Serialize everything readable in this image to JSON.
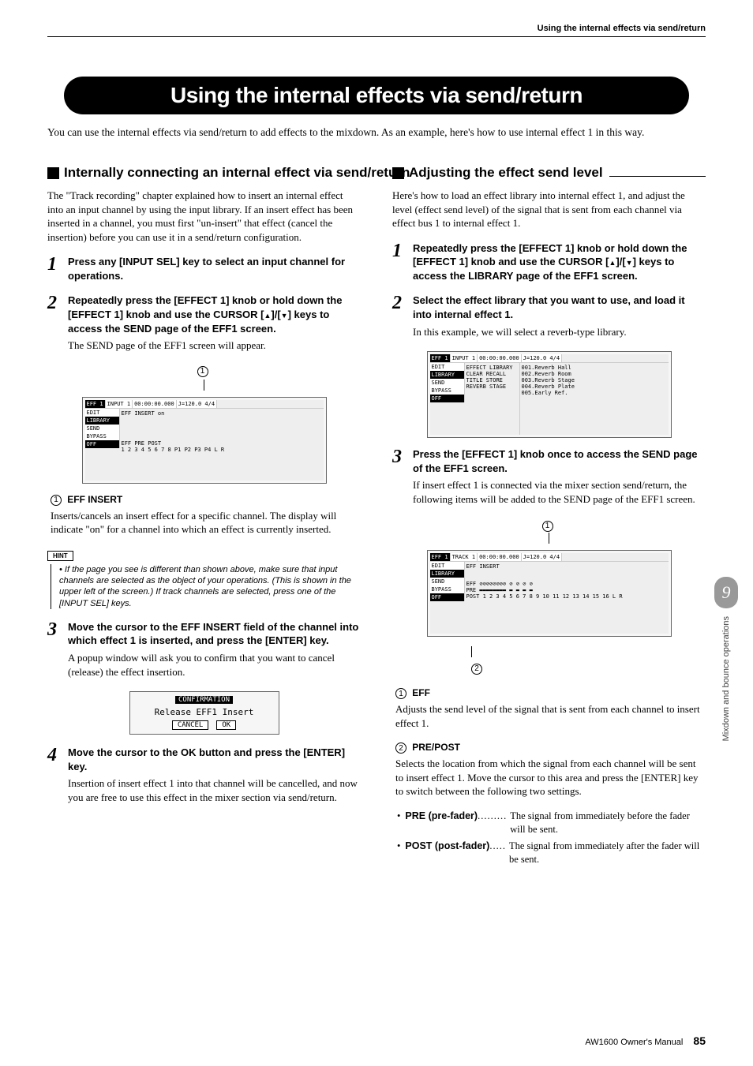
{
  "header": {
    "section": "Using the internal effects via send/return"
  },
  "title": "Using the internal effects via send/return",
  "intro": "You can use the internal effects via send/return to add effects to the mixdown. As an example, here's how to use internal effect 1 in this way.",
  "left": {
    "heading": "Internally connecting an internal effect via send/return",
    "para1": "The \"Track recording\" chapter explained how to insert an internal effect into an input channel by using the input library. If an insert effect has been inserted in a channel, you must first \"un-insert\" that effect (cancel the insertion) before you can use it in a send/return configuration.",
    "step1": {
      "num": "1",
      "title": "Press any [INPUT SEL] key to select an input channel for operations."
    },
    "step2": {
      "num": "2",
      "title_a": "Repeatedly press the [EFFECT 1] knob or hold down the [EFFECT 1] knob and use the CURSOR [",
      "title_b": "]/[",
      "title_c": "] keys to access the SEND page of the EFF1 screen.",
      "desc": "The SEND page of the EFF1 screen will appear."
    },
    "callout1": {
      "num": "1",
      "label": "EFF INSERT",
      "desc": "Inserts/cancels an insert effect for a specific channel. The display will indicate \"on\" for a channel into which an effect is currently inserted."
    },
    "hint": {
      "label": "HINT",
      "text": "• If the page you see is different than shown above, make sure that input channels are selected as the object of your operations. (This is shown in the upper left of the screen.) If track channels are selected, press one of the [INPUT SEL] keys."
    },
    "step3": {
      "num": "3",
      "title": "Move the cursor to the EFF INSERT field of the channel into which effect 1 is inserted, and press the [ENTER] key.",
      "desc": "A popup window will ask you to confirm that you want to cancel (release) the effect insertion."
    },
    "confirm": {
      "header": "CONFIRMATION",
      "text": "Release EFF1  Insert",
      "cancel": "CANCEL",
      "ok": "OK"
    },
    "step4": {
      "num": "4",
      "title": "Move the cursor to the OK button and press the [ENTER] key.",
      "desc": "Insertion of insert effect 1 into that channel will be cancelled, and now you are free to use this effect in the mixer section via send/return."
    }
  },
  "right": {
    "heading": "Adjusting the effect send level",
    "para1": "Here's how to load an effect library into internal effect 1, and adjust the level (effect send level) of the signal that is sent from each channel via effect bus 1 to internal effect 1.",
    "step1": {
      "num": "1",
      "title_a": "Repeatedly press the [EFFECT 1] knob or hold down the [EFFECT 1] knob and use the CURSOR [",
      "title_b": "]/[",
      "title_c": "] keys to access the LIBRARY page of the EFF1 screen."
    },
    "step2": {
      "num": "2",
      "title": "Select the effect library that you want to use, and load it into internal effect 1.",
      "desc": "In this example, we will select a reverb-type library."
    },
    "library_items": [
      "001.Reverb Hall",
      "002.Reverb Room",
      "003.Reverb Stage",
      "004.Reverb Plate",
      "005.Early Ref."
    ],
    "step3": {
      "num": "3",
      "title": "Press the [EFFECT 1] knob once to access the SEND page of the EFF1 screen.",
      "desc": "If insert effect 1 is connected via the mixer section send/return, the following items will be added to the SEND page of the EFF1 screen."
    },
    "callout1": {
      "num": "1",
      "label": "EFF",
      "desc": "Adjusts the send level of the signal that is sent from each channel to insert effect 1."
    },
    "callout2": {
      "num": "2",
      "label": "PRE/POST",
      "desc": "Selects the location from which the signal from each channel will be sent to insert effect 1. Move the cursor to this area and press the [ENTER] key to switch between the following two settings."
    },
    "bullets": {
      "pre": {
        "label": "PRE (pre-fader)",
        "desc": "The signal from immediately before the fader will be sent."
      },
      "post": {
        "label": "POST (post-fader)",
        "desc": "The signal from immediately after the fader will be sent."
      }
    }
  },
  "lcd": {
    "screen_label": "EFF 1",
    "tabs": [
      "EDIT",
      "LIBRARY",
      "SEND",
      "BYPASS",
      "OFF"
    ],
    "input": "INPUT  1",
    "track": "TRACK  1",
    "time": "00:00:00.000",
    "tempo": "J=120.0 4/4",
    "sub_labels": [
      "EFF",
      "INSERT",
      "PRE",
      "POST"
    ],
    "lib_header": "EFFECT LIBRARY",
    "lib_btns": [
      "CLEAR",
      "RECALL",
      "TITLE",
      "STORE"
    ],
    "lib_footer": "REVERB STAGE"
  },
  "side": {
    "chapter": "9",
    "label": "Mixdown and bounce operations"
  },
  "footer": {
    "manual": "AW1600  Owner's Manual",
    "page": "85"
  }
}
